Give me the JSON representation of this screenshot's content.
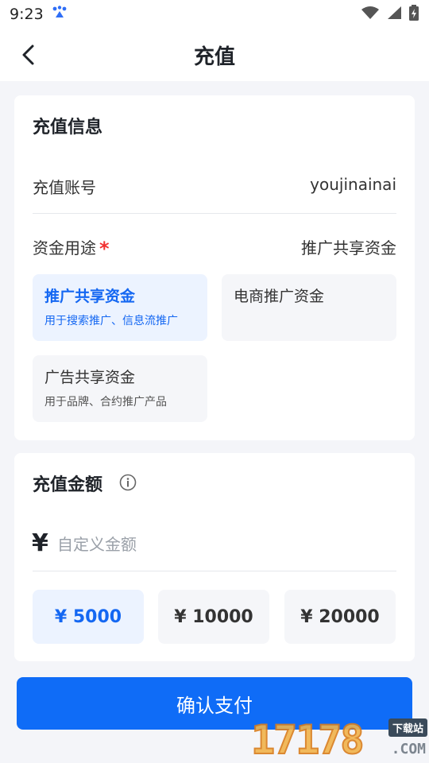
{
  "status_bar": {
    "time": "9:23"
  },
  "nav": {
    "title": "充值"
  },
  "recharge_info": {
    "title": "充值信息",
    "account_label": "充值账号",
    "account_value": "youjinainai",
    "purpose_label": "资金用途",
    "required_mark": "*",
    "purpose_value": "推广共享资金",
    "options": [
      {
        "title": "推广共享资金",
        "desc": "用于搜索推广、信息流推广",
        "selected": true
      },
      {
        "title": "电商推广资金",
        "desc": "",
        "selected": false
      },
      {
        "title": "广告共享资金",
        "desc": "用于品牌、合约推广产品",
        "selected": false
      }
    ]
  },
  "recharge_amount": {
    "title": "充值金额",
    "currency_symbol": "¥",
    "placeholder": "自定义金额",
    "presets": [
      {
        "label": "¥ 5000",
        "selected": true
      },
      {
        "label": "¥ 10000",
        "selected": false
      },
      {
        "label": "¥ 20000",
        "selected": false
      }
    ]
  },
  "confirm_button": {
    "label": "确认支付"
  },
  "watermark": {
    "text": "17178",
    "tag": "下载站",
    "domain": ".COM"
  },
  "colors": {
    "accent": "#0f6cf7",
    "accent_text": "#1467f2",
    "selected_bg": "#ecf3ff",
    "option_bg": "#f5f6f9",
    "required": "#f23030"
  }
}
